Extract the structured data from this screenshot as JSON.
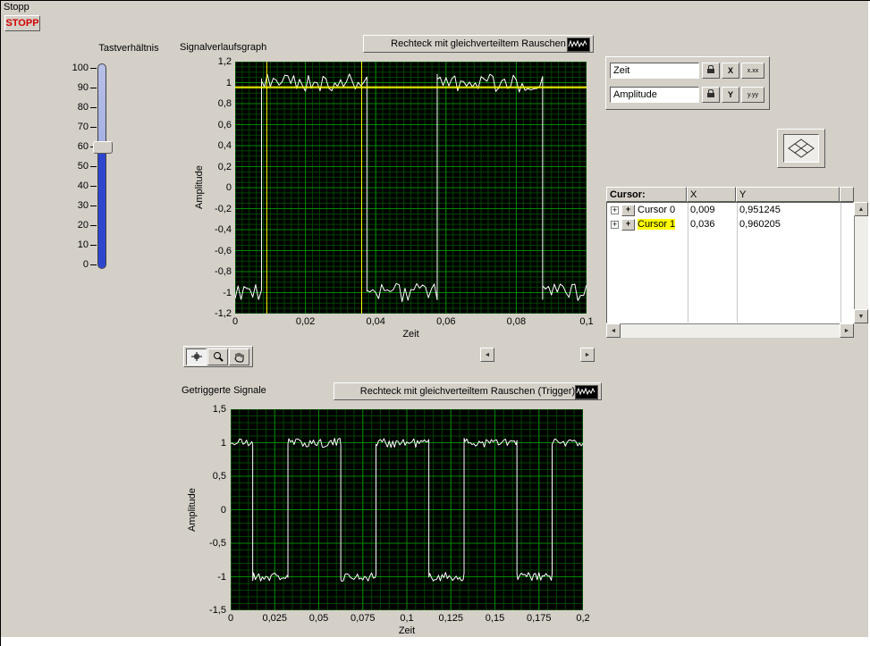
{
  "window": {
    "bg": "#d4d0c8"
  },
  "colors": {
    "stop_text": "#d40000",
    "slider_fill": "#2e46cf",
    "cursor_highlight": "#ffff00",
    "plot_bg": "#000000",
    "trace": "#ffffff"
  },
  "stop_control": {
    "label": "Stopp",
    "button_label": "STOPP"
  },
  "slider": {
    "label": "Tastverhältnis",
    "scale_labels": [
      "100",
      "90",
      "80",
      "70",
      "60",
      "50",
      "40",
      "30",
      "20",
      "10",
      "0"
    ],
    "value": 60,
    "min": 0,
    "max": 100
  },
  "graph1": {
    "label": "Signalverlaufsgraph",
    "title": "Rechteck mit gleichverteiltem Rauschen",
    "xlabel": "Zeit",
    "ylabel": "Amplitude"
  },
  "graph2": {
    "label": "Getriggerte Signale",
    "title": "Rechteck mit gleichverteiltem Rauschen (Trigger)",
    "xlabel": "Zeit",
    "ylabel": "Amplitude"
  },
  "scale_legend": {
    "x_name": "Zeit",
    "y_name": "Amplitude",
    "x_axis_label": "X",
    "y_axis_label": "Y",
    "x_format_label": "x.xx",
    "y_format_label": "y.yy"
  },
  "cursor_panel": {
    "header_name": "Cursor:",
    "header_x": "X",
    "header_y": "Y",
    "rows": [
      {
        "name": "Cursor 0",
        "x": "0,009",
        "y": "0,951245",
        "highlighted": false
      },
      {
        "name": "Cursor 1",
        "x": "0,036",
        "y": "0,960205",
        "highlighted": true
      }
    ]
  },
  "icons": {
    "scroll-left": "◄",
    "scroll-right": "►",
    "scroll-up": "▲",
    "scroll-down": "▼",
    "expander-plus": "+",
    "cursor-style": "+"
  },
  "chart_data": [
    {
      "name": "signalverlaufsgraph",
      "type": "line",
      "title": "Rechteck mit gleichverteiltem Rauschen",
      "xlabel": "Zeit",
      "ylabel": "Amplitude",
      "xlim": [
        0,
        0.1
      ],
      "ylim": [
        -1.2,
        1.2
      ],
      "xtick_labels": [
        "0",
        "0,02",
        "0,04",
        "0,06",
        "0,08",
        "0,1"
      ],
      "ytick_labels": [
        "1,2",
        "1",
        "0,8",
        "0,6",
        "0,4",
        "0,2",
        "0",
        "-0,2",
        "-0,4",
        "-0,6",
        "-0,8",
        "-1",
        "-1,2"
      ],
      "grid": {
        "minor_x": 0.002,
        "minor_y": 0.05,
        "major_x": 0.02,
        "major_y": 0.2,
        "minor_color": "#004400",
        "major_color": "#008800"
      },
      "plot_bg": "#000000",
      "legend_position": "top-center",
      "series": [
        {
          "name": "Rechteck mit gleichverteiltem Rauschen",
          "signal": "square_with_uniform_noise",
          "amplitude": 1,
          "period": 0.05,
          "duty": 0.6,
          "phase": 0.0075,
          "noise": 0.09,
          "samples": 120,
          "seed": 9,
          "color": "#ffffff"
        }
      ],
      "cursors": [
        {
          "name": "Cursor 0",
          "x": 0.009,
          "y": 0.951245,
          "color": "#ffff00"
        },
        {
          "name": "Cursor 1",
          "x": 0.036,
          "y": 0.960205,
          "color": "#ffff00"
        }
      ]
    },
    {
      "name": "getriggerte-signale",
      "type": "line",
      "title": "Rechteck mit gleichverteiltem Rauschen (Trigger)",
      "xlabel": "Zeit",
      "ylabel": "Amplitude",
      "xlim": [
        0,
        0.2
      ],
      "ylim": [
        -1.5,
        1.5
      ],
      "xtick_labels": [
        "0",
        "0,025",
        "0,05",
        "0,075",
        "0,1",
        "0,125",
        "0,15",
        "0,175",
        "0,2"
      ],
      "ytick_labels": [
        "1,5",
        "1",
        "0,5",
        "0",
        "-0,5",
        "-1",
        "-1,5"
      ],
      "grid": {
        "minor_x": 0.005,
        "minor_y": 0.1,
        "major_x": 0.025,
        "major_y": 0.5,
        "minor_color": "#004400",
        "major_color": "#008800"
      },
      "plot_bg": "#000000",
      "legend_position": "top-center",
      "series": [
        {
          "name": "Rechteck mit gleichverteiltem Rauschen (Trigger)",
          "signal": "square_with_uniform_noise",
          "amplitude": 1,
          "period": 0.05,
          "duty": 0.6,
          "phase": -0.0175,
          "noise": 0.07,
          "samples": 200,
          "seed": 21,
          "color": "#ffffff"
        }
      ],
      "cursors": []
    }
  ]
}
